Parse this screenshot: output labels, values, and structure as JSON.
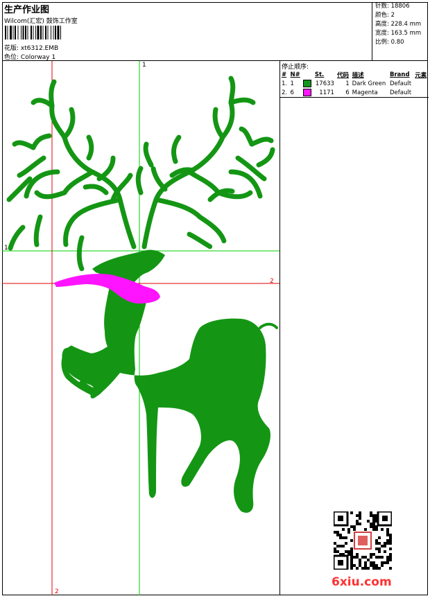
{
  "header": {
    "title": "生产作业图",
    "company": "Wilcom(汇宏) 鼓饰工作室",
    "design_label": "花版:",
    "design_value": "xt6312.EMB",
    "color_label": "色位:",
    "color_value": "Colorway 1"
  },
  "stats": [
    {
      "label": "针数:",
      "value": "18806"
    },
    {
      "label": "颜色:",
      "value": "2"
    },
    {
      "label": "高度:",
      "value": "228.4 mm"
    },
    {
      "label": "宽度:",
      "value": "163.5 mm"
    },
    {
      "label": "比例:",
      "value": "0.80"
    }
  ],
  "stop_sequence": {
    "title": "停止顺序:",
    "columns": [
      "#",
      "N#",
      "St.",
      "代码",
      "描述",
      "Brand",
      "元素"
    ],
    "rows": [
      {
        "num": "1.",
        "n": "1",
        "color": "#14961e",
        "stitches": "17633",
        "code": "1",
        "desc": "Dark Green",
        "brand": "Default"
      },
      {
        "num": "2.",
        "n": "6",
        "color": "#ff14ff",
        "stitches": "1171",
        "code": "6",
        "desc": "Magenta",
        "brand": "Default"
      }
    ]
  },
  "guides": {
    "green_v": "1",
    "green_h": "1",
    "red_h": "2",
    "red_v": "2"
  },
  "colors": {
    "green": "#149614",
    "magenta": "#ff14ff",
    "guide_green": "#00d000",
    "guide_red": "#e00000"
  },
  "watermark": "6xiu.com"
}
